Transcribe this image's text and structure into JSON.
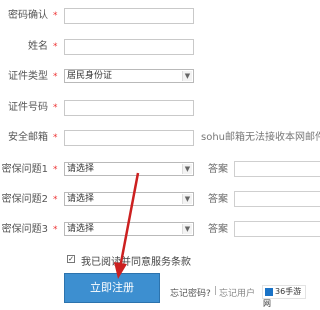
{
  "form": {
    "password_confirm_label": "密码确认",
    "name_label": "姓名",
    "id_type_label": "证件类型",
    "id_type_value": "居民身份证",
    "id_number_label": "证件号码",
    "email_label": "安全邮箱",
    "email_hint": "sohu邮箱无法接收本网邮件",
    "required_mark": "*",
    "questions": [
      {
        "label": "密保问题1",
        "select_value": "请选择",
        "answer_label": "答案"
      },
      {
        "label": "密保问题2",
        "select_value": "请选择",
        "answer_label": "答案"
      },
      {
        "label": "密保问题3",
        "select_value": "请选择",
        "answer_label": "答案"
      }
    ],
    "agree_text": "我已阅读并同意服务条款",
    "submit_label": "立即注册",
    "forgot_password": "忘记密码?",
    "separator": "|",
    "other_link": "忘记用户",
    "logo_text": "36手游网"
  },
  "colors": {
    "button_bg": "#3d8fd0",
    "arrow": "#cc2020",
    "required": "#e33333"
  }
}
